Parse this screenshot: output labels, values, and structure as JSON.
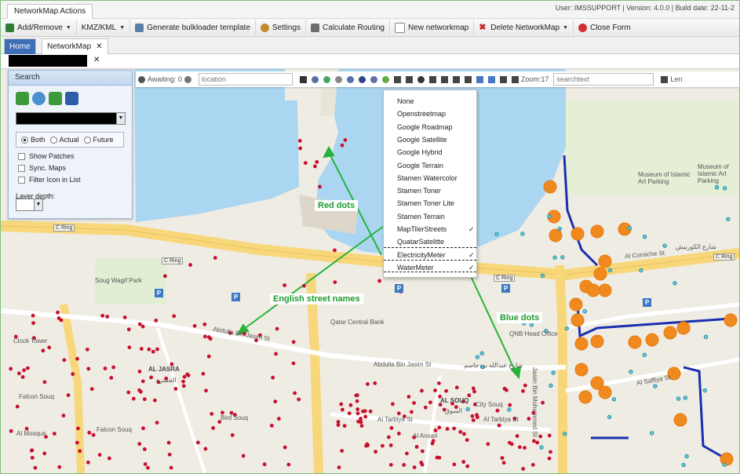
{
  "window": {
    "tab_title": "NetworkMap Actions",
    "build_info": "User: IMSSUPPORT | Version: 4.0.0 | Build date: 22-11-2"
  },
  "toolbar": {
    "items": [
      {
        "label": "Add/Remove",
        "icon": "add-remove-icon",
        "has_menu": true
      },
      {
        "label": "KMZ/KML",
        "icon": "",
        "has_menu": true
      },
      {
        "label": "Generate bulkloader template",
        "icon": "template-icon",
        "has_menu": false
      },
      {
        "label": "Settings",
        "icon": "settings-icon",
        "has_menu": false
      },
      {
        "label": "Calculate Routing",
        "icon": "routing-icon",
        "has_menu": false
      },
      {
        "label": "New networkmap",
        "icon": "new-doc-icon",
        "has_menu": false
      },
      {
        "label": "Delete NetworkMap",
        "icon": "delete-icon",
        "has_menu": true
      },
      {
        "label": "Close Form",
        "icon": "close-form-icon",
        "has_menu": false
      }
    ]
  },
  "doc_tabs": {
    "home": "Home",
    "networkmap": "NetworkMap",
    "close_glyph": "✕"
  },
  "map_toolbar": {
    "awaiting": "Awaiting: 0",
    "location_placeholder": "location",
    "zoom": "Zoom:17",
    "search_placeholder": "searchtext",
    "legend": "Len"
  },
  "search_panel": {
    "title": "Search",
    "radio_options": [
      "Both",
      "Actual",
      "Future"
    ],
    "selected_radio": "Both",
    "checkboxes": [
      "Show Patches",
      "Sync. Maps",
      "Filter Icon in List"
    ],
    "layer_depth_label": "Layer depth:"
  },
  "layer_dropdown": {
    "items": [
      {
        "label": "None",
        "checked": false
      },
      {
        "label": "Openstreetmap",
        "checked": false
      },
      {
        "label": "Google Roadmap",
        "checked": false
      },
      {
        "label": "Google Satellite",
        "checked": false
      },
      {
        "label": "Google Hybrid",
        "checked": false
      },
      {
        "label": "Google Terrain",
        "checked": false
      },
      {
        "label": "Stamen Watercolor",
        "checked": false
      },
      {
        "label": "Stamen Toner",
        "checked": false
      },
      {
        "label": "Stamen Toner Lite",
        "checked": false
      },
      {
        "label": "Stamen Terrain",
        "checked": false
      },
      {
        "label": "MapTilerStreets",
        "checked": true
      },
      {
        "label": "QuatarSatelitte",
        "checked": false
      },
      {
        "label": "ElectricityMeter",
        "checked": true
      },
      {
        "label": "WaterMeter",
        "checked": true
      }
    ],
    "check_glyph": "✓"
  },
  "annotations": {
    "red_dots": "Red dots",
    "english_names": "English street names",
    "blue_dots": "Blue dots"
  },
  "map_labels": {
    "c_ring_1": "C Ring",
    "c_ring_2": "C Ring",
    "c_ring_3": "C Ring",
    "c_ring_4": "C Ring",
    "souq_wagif_park": "Soug Wagif Park",
    "qatar_central_bank": "Qatar Central Bank",
    "qnb_head_office": "QNB Head Office",
    "abdulla_bin_jasim_1": "Abdulla Bin Jasim St",
    "abdulla_bin_jasim_2": "Abdulla Bin Jasim St",
    "abdulla_arabic": "شارع عبدالله بن جاسم",
    "al_jasra": "AL JASRA",
    "al_jasra_ar": "الجسرة",
    "falcon_souq_1": "Falcon Souq",
    "falcon_souq_2": "Falcon Souq",
    "bird_souq": "Bird Souq",
    "clock_tower": "Clock Tower",
    "al_souq": "AL SOUQ",
    "al_souq_ar": "السوق",
    "city_souq": "City Souq",
    "al_tarbiya_1": "Al Tarbiya St",
    "al_tarbiya_2": "Al Tarbiya St",
    "al_corniche": "Al Corniche St",
    "al_corniche_ar": "شارع الكورنيش",
    "museum_islamic_1": "Museum of Islamic Art Parking",
    "museum_islamic_2": "Museum of Islamic Art Parking",
    "al_saffiya": "Al Saffiya St",
    "jasim_bin_mohammed": "Jasim Bin Mohammed St",
    "al_ansari": "Al Ansari",
    "al_mosque": "Al Mosque",
    "p": "P"
  }
}
